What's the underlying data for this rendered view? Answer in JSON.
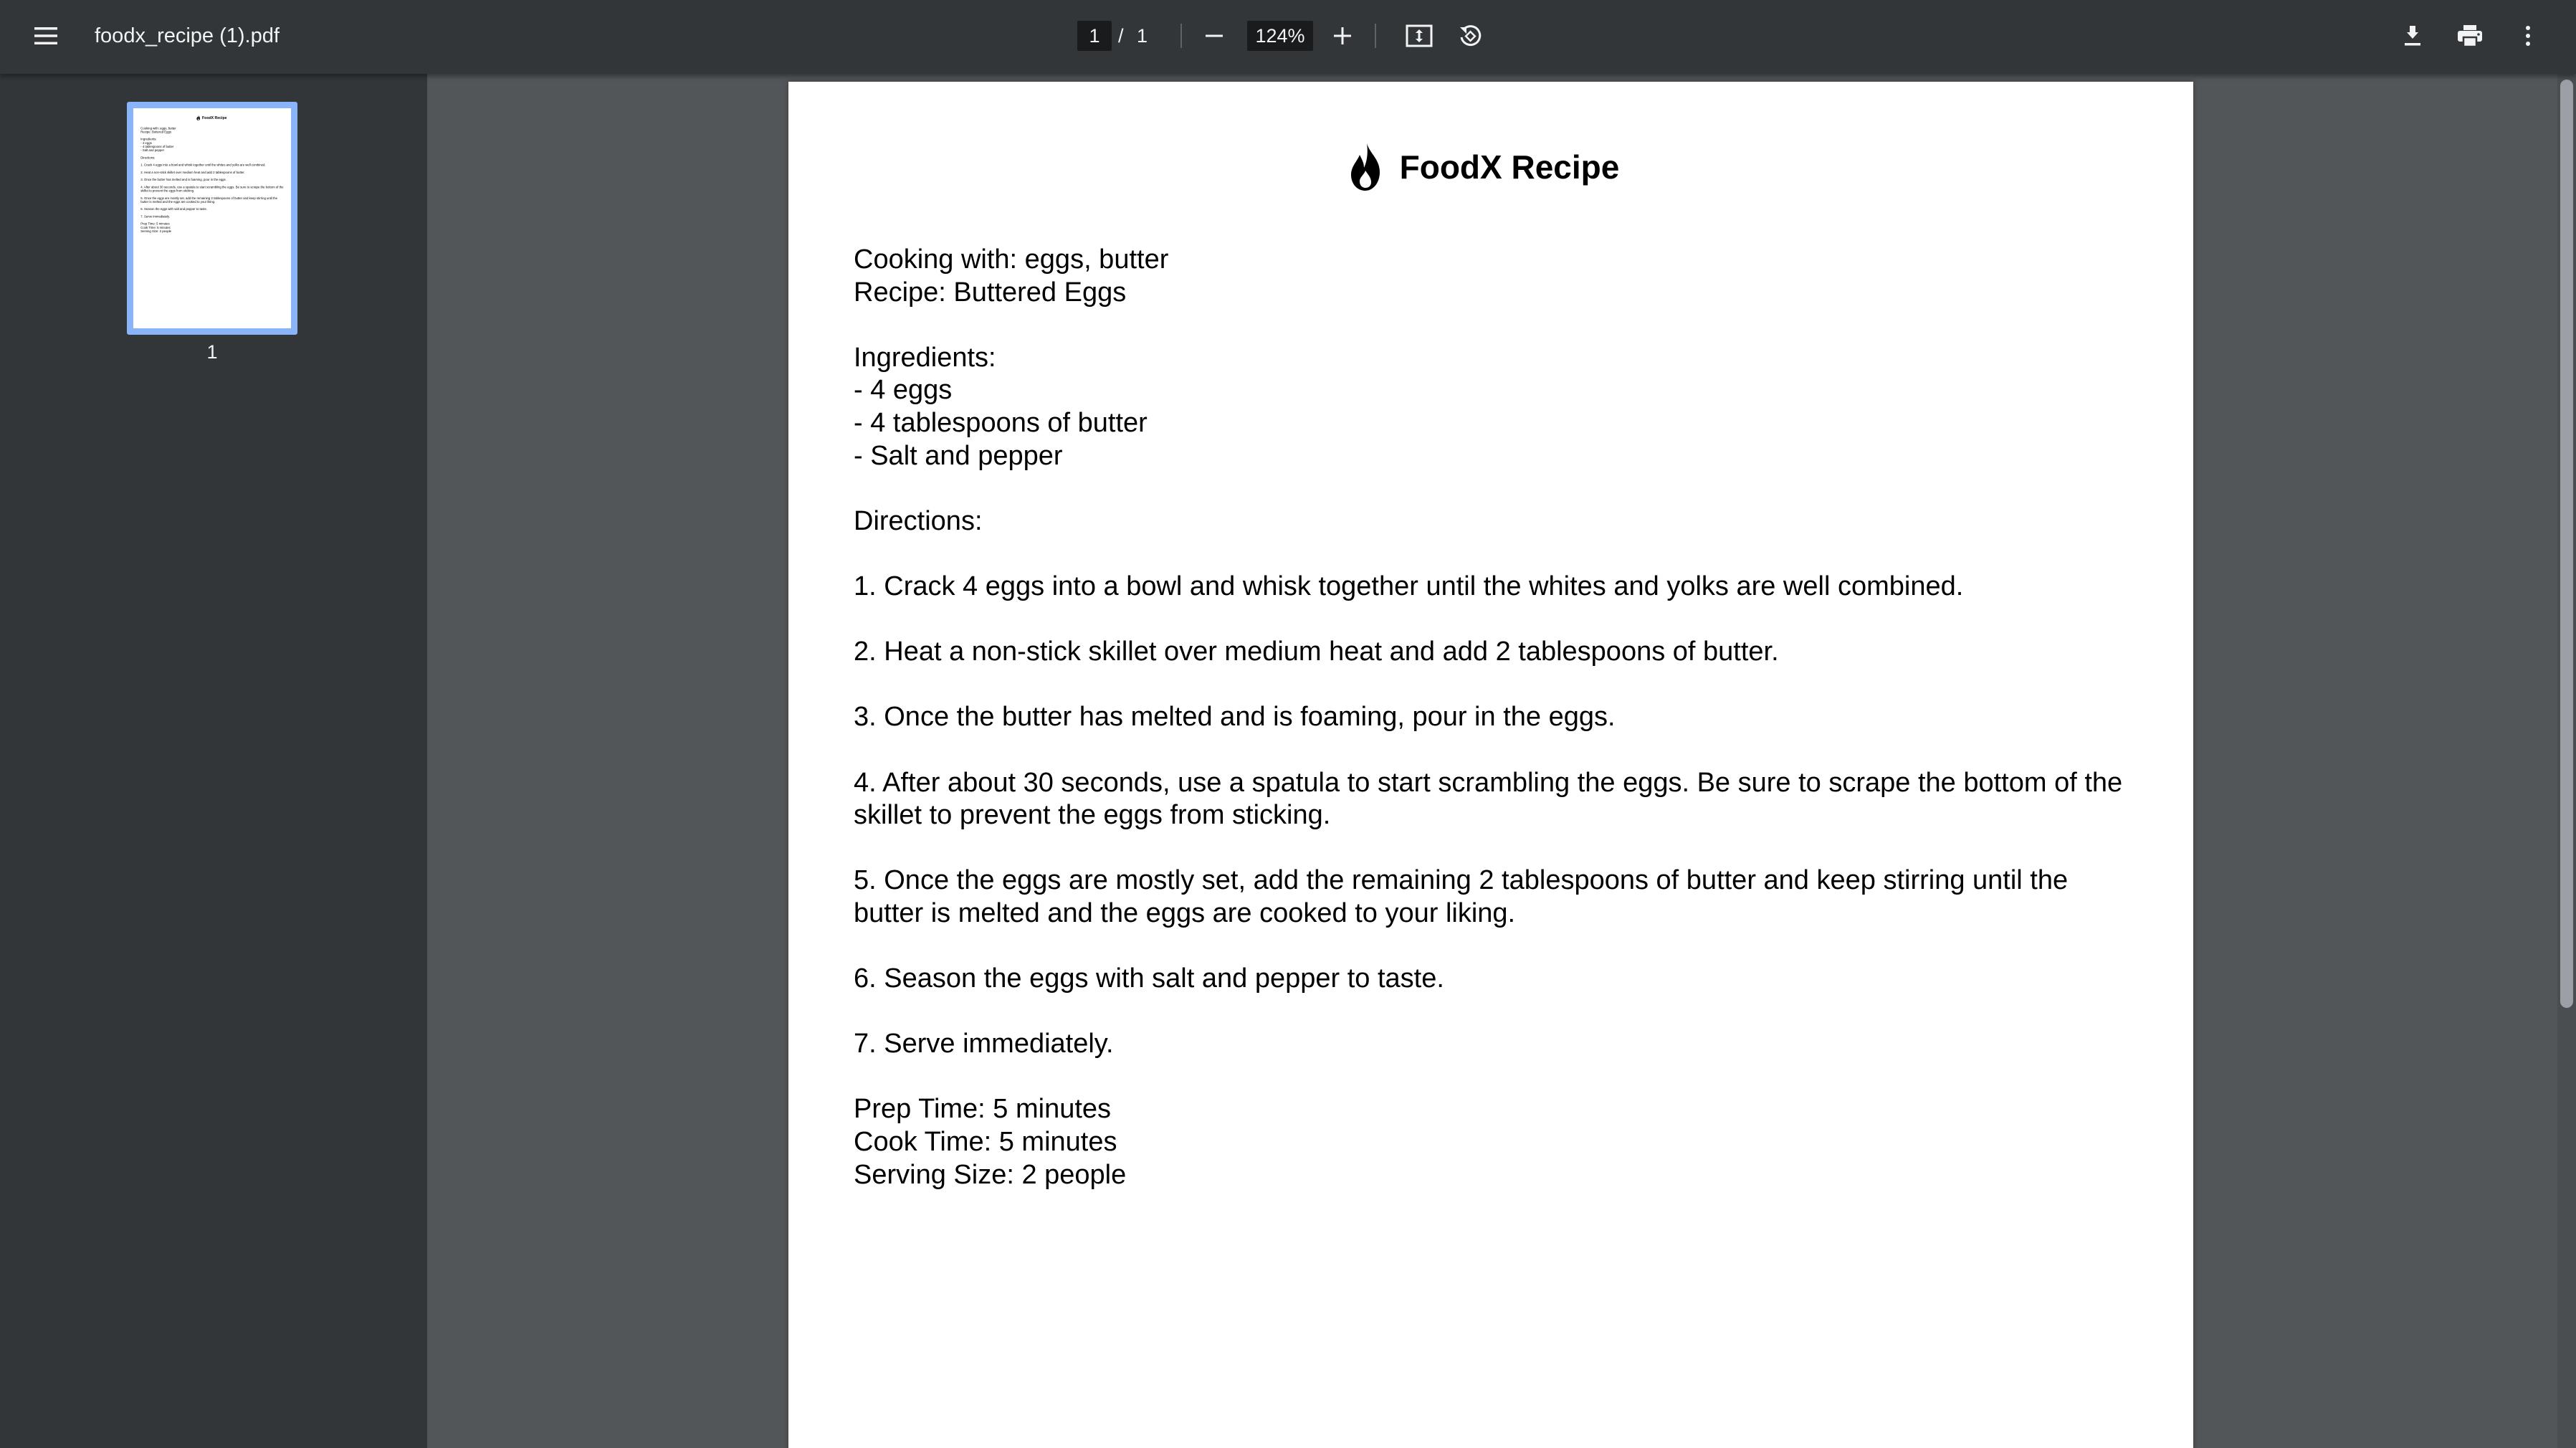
{
  "toolbar": {
    "menu_icon": "menu-icon",
    "file_name": "foodx_recipe (1).pdf",
    "current_page": "1",
    "page_separator": "/",
    "total_pages": "1",
    "zoom_out_icon": "minus-icon",
    "zoom_level": "124%",
    "zoom_in_icon": "plus-icon",
    "fit_icon": "fit-to-page-icon",
    "rotate_icon": "rotate-counterclockwise-icon",
    "download_icon": "download-icon",
    "print_icon": "print-icon",
    "more_icon": "more-vert-icon"
  },
  "sidebar": {
    "thumbnails": [
      {
        "label": "1",
        "selected": true
      }
    ]
  },
  "document": {
    "logo_icon": "flame-icon",
    "title": "FoodX Recipe",
    "cooking_with": "Cooking with: eggs, butter",
    "recipe": "Recipe: Buttered Eggs",
    "ingredients_heading": "Ingredients:",
    "ingredients": [
      "- 4 eggs",
      "- 4 tablespoons of butter",
      "- Salt and pepper"
    ],
    "directions_heading": "Directions:",
    "directions": [
      "1. Crack 4 eggs into a bowl and whisk together until the whites and yolks are well combined.",
      "2. Heat a non-stick skillet over medium heat and add 2 tablespoons of butter.",
      "3. Once the butter has melted and is foaming, pour in the eggs.",
      "4. After about 30 seconds, use a spatula to start scrambling the eggs. Be sure to scrape the bottom of the skillet to prevent the eggs from sticking.",
      "5. Once the eggs are mostly set, add the remaining 2 tablespoons of butter and keep stirring until the butter is melted and the eggs are cooked to your liking.",
      "6. Season the eggs with salt and pepper to taste.",
      "7. Serve immediately."
    ],
    "prep_time": "Prep Time: 5 minutes",
    "cook_time": "Cook Time: 5 minutes",
    "serving_size": "Serving Size: 2 people"
  },
  "colors": {
    "toolbar_bg": "#323639",
    "viewer_bg": "#525659",
    "thumbnail_selected_border": "#8ab4f8",
    "page_bg": "#ffffff"
  }
}
